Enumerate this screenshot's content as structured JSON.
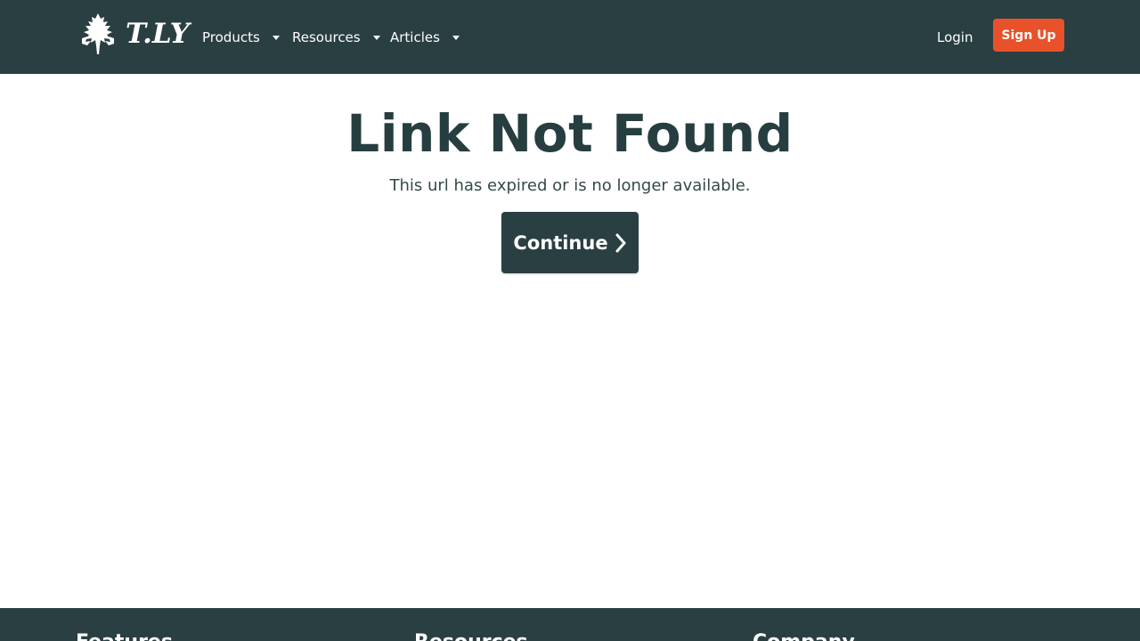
{
  "header": {
    "logo_text": "T.LY",
    "nav": [
      {
        "label": "Products"
      },
      {
        "label": "Resources"
      },
      {
        "label": "Articles"
      }
    ],
    "login_label": "Login",
    "signup_label": "Sign Up"
  },
  "main": {
    "title": "Link Not Found",
    "subtitle": "This url has expired or is no longer available.",
    "continue_label": "Continue"
  },
  "footer": {
    "columns": [
      {
        "heading": "Features"
      },
      {
        "heading": "Resources"
      },
      {
        "heading": "Company"
      }
    ]
  },
  "colors": {
    "header_bg": "#2a3f42",
    "signup_bg": "#e8512a",
    "title_text": "#273e40"
  },
  "icons": {
    "logo": "tree-icon",
    "nav_caret": "caret-down-icon",
    "continue": "chevron-right-icon"
  }
}
